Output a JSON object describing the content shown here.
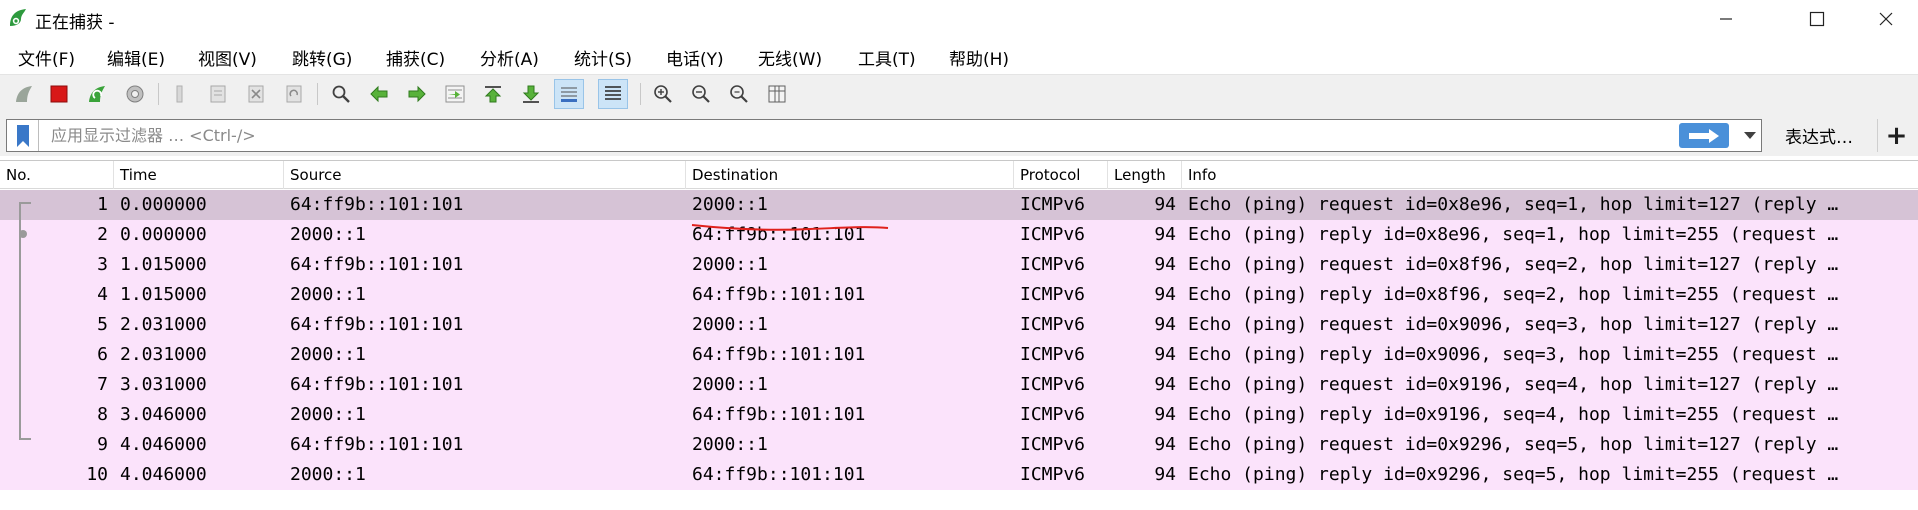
{
  "window": {
    "title": "正在捕获 -",
    "controls": [
      "minimize",
      "maximize",
      "close"
    ]
  },
  "menu": [
    {
      "label": "文件(F)"
    },
    {
      "label": "编辑(E)"
    },
    {
      "label": "视图(V)"
    },
    {
      "label": "跳转(G)"
    },
    {
      "label": "捕获(C)"
    },
    {
      "label": "分析(A)"
    },
    {
      "label": "统计(S)"
    },
    {
      "label": "电话(Y)"
    },
    {
      "label": "无线(W)"
    },
    {
      "label": "工具(T)"
    },
    {
      "label": "帮助(H)"
    }
  ],
  "toolbar": {
    "buttons": [
      "start-capture-icon",
      "stop-capture-icon",
      "restart-capture-icon",
      "capture-options-icon",
      "open-file-icon",
      "save-file-icon",
      "close-file-icon",
      "reload-file-icon",
      "find-packet-icon",
      "go-back-icon",
      "go-forward-icon",
      "go-to-packet-icon",
      "go-first-packet-icon",
      "go-last-packet-icon",
      "autoscroll-icon",
      "colorize-icon",
      "zoom-in-icon",
      "zoom-out-icon",
      "zoom-normal-icon",
      "resize-columns-icon"
    ],
    "active": [
      "autoscroll-icon",
      "colorize-icon"
    ]
  },
  "filter": {
    "placeholder": "应用显示过滤器 … <Ctrl-/>",
    "value": "",
    "expression_label": "表达式…",
    "add_label": "+"
  },
  "packet_list": {
    "columns": [
      "No.",
      "Time",
      "Source",
      "Destination",
      "Protocol",
      "Length",
      "Info"
    ],
    "rows": [
      {
        "no": "1",
        "time": "0.000000",
        "source": "64:ff9b::101:101",
        "destination": "2000::1",
        "protocol": "ICMPv6",
        "length": "94",
        "info": "Echo (ping) request id=0x8e96, seq=1, hop limit=127 (reply …",
        "selected": true
      },
      {
        "no": "2",
        "time": "0.000000",
        "source": "2000::1",
        "destination": "64:ff9b::101:101",
        "protocol": "ICMPv6",
        "length": "94",
        "info": "Echo (ping) reply id=0x8e96, seq=1, hop limit=255 (request …",
        "selected": false
      },
      {
        "no": "3",
        "time": "1.015000",
        "source": "64:ff9b::101:101",
        "destination": "2000::1",
        "protocol": "ICMPv6",
        "length": "94",
        "info": "Echo (ping) request id=0x8f96, seq=2, hop limit=127 (reply …",
        "selected": false
      },
      {
        "no": "4",
        "time": "1.015000",
        "source": "2000::1",
        "destination": "64:ff9b::101:101",
        "protocol": "ICMPv6",
        "length": "94",
        "info": "Echo (ping) reply id=0x8f96, seq=2, hop limit=255 (request …",
        "selected": false
      },
      {
        "no": "5",
        "time": "2.031000",
        "source": "64:ff9b::101:101",
        "destination": "2000::1",
        "protocol": "ICMPv6",
        "length": "94",
        "info": "Echo (ping) request id=0x9096, seq=3, hop limit=127 (reply …",
        "selected": false
      },
      {
        "no": "6",
        "time": "2.031000",
        "source": "2000::1",
        "destination": "64:ff9b::101:101",
        "protocol": "ICMPv6",
        "length": "94",
        "info": "Echo (ping) reply id=0x9096, seq=3, hop limit=255 (request …",
        "selected": false
      },
      {
        "no": "7",
        "time": "3.031000",
        "source": "64:ff9b::101:101",
        "destination": "2000::1",
        "protocol": "ICMPv6",
        "length": "94",
        "info": "Echo (ping) request id=0x9196, seq=4, hop limit=127 (reply …",
        "selected": false
      },
      {
        "no": "8",
        "time": "3.046000",
        "source": "2000::1",
        "destination": "64:ff9b::101:101",
        "protocol": "ICMPv6",
        "length": "94",
        "info": "Echo (ping) reply id=0x9196, seq=4, hop limit=255 (request …",
        "selected": false
      },
      {
        "no": "9",
        "time": "4.046000",
        "source": "64:ff9b::101:101",
        "destination": "2000::1",
        "protocol": "ICMPv6",
        "length": "94",
        "info": "Echo (ping) request id=0x9296, seq=5, hop limit=127 (reply …",
        "selected": false
      },
      {
        "no": "10",
        "time": "4.046000",
        "source": "2000::1",
        "destination": "64:ff9b::101:101",
        "protocol": "ICMPv6",
        "length": "94",
        "info": "Echo (ping) reply id=0x9296, seq=5, hop limit=255 (request …",
        "selected": false
      }
    ]
  },
  "colors": {
    "row_bg": "#fbe3fb",
    "selected_bg": "#d6c3d6",
    "annotation": "#e0201c",
    "app_icon": "#2e9a3e"
  }
}
